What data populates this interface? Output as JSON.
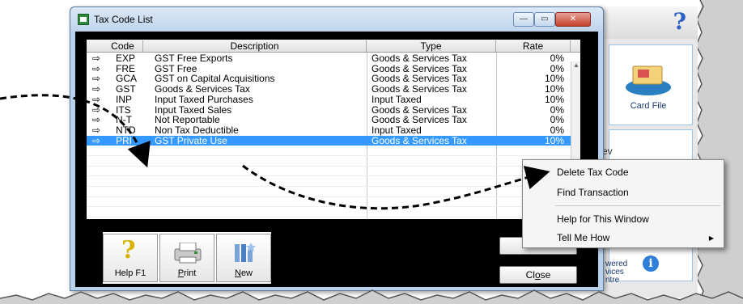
{
  "window": {
    "title": "Tax Code List",
    "min_glyph": "—",
    "max_glyph": "▭",
    "close_glyph": "✕"
  },
  "table": {
    "headers": [
      "Code",
      "Description",
      "Type",
      "Rate"
    ],
    "arrow_glyph": "⇨",
    "rows": [
      {
        "code": "EXP",
        "description": "GST Free Exports",
        "type": "Goods & Services Tax",
        "rate": "0%"
      },
      {
        "code": "FRE",
        "description": "GST Free",
        "type": "Goods & Services Tax",
        "rate": "0%"
      },
      {
        "code": "GCA",
        "description": "GST on Capital Acquisitions",
        "type": "Goods & Services Tax",
        "rate": "10%"
      },
      {
        "code": "GST",
        "description": "Goods & Services Tax",
        "type": "Goods & Services Tax",
        "rate": "10%"
      },
      {
        "code": "INP",
        "description": "Input Taxed Purchases",
        "type": "Input Taxed",
        "rate": "10%"
      },
      {
        "code": "ITS",
        "description": "Input Taxed Sales",
        "type": "Goods & Services Tax",
        "rate": "0%"
      },
      {
        "code": "N-T",
        "description": "Not Reportable",
        "type": "Goods & Services Tax",
        "rate": "0%"
      },
      {
        "code": "NTD",
        "description": "Non Tax Deductible",
        "type": "Input Taxed",
        "rate": "0%"
      },
      {
        "code": "PRI",
        "description": "GST Private Use",
        "type": "Goods & Services Tax",
        "rate": "10%"
      }
    ],
    "selected_index": 8
  },
  "toolbar": {
    "help_label": "Help F1",
    "print_label_u": "P",
    "print_label_rest": "rint",
    "new_label_u": "N",
    "new_label_rest": "ew"
  },
  "buttons": {
    "close_pre": "Cl",
    "close_u": "o",
    "close_post": "se"
  },
  "context_menu": {
    "items": [
      "Delete Tax Code",
      "Find Transaction",
      "Help for This Window",
      "Tell Me How"
    ],
    "submenu_arrow": "▶"
  },
  "background_app": {
    "help_glyph": "?",
    "card_file_label": "Card File",
    "partial_text": "ev",
    "powered_lines": [
      "wered",
      "vices",
      "ntre"
    ],
    "info_glyph": "i"
  },
  "colors": {
    "selection": "#3399ff",
    "window_frame": "#b9d1ea",
    "client_bg": "#000000"
  }
}
